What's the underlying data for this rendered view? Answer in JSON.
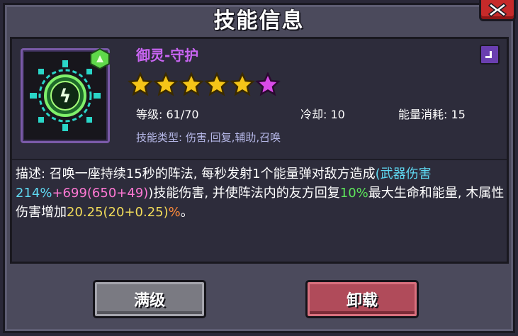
{
  "dialog": {
    "title": "技能信息",
    "close_icon": "close-icon"
  },
  "skill": {
    "name": "御灵-守护",
    "icon": "summon-array-icon",
    "element_badge": "wood-element-icon",
    "corner_badge": "purple-rarity-icon",
    "stars": {
      "total": 6,
      "gold": 5,
      "purple": 1
    },
    "level_label": "等级:",
    "level_value": "61/70",
    "cooldown_label": "冷却:",
    "cooldown_value": "10",
    "energy_label": "能量消耗:",
    "energy_value": "15",
    "type_text": "技能类型: 伤害,回复,辅助,召唤"
  },
  "description": {
    "p1": "描述: 召唤一座持续15秒的阵法, 每秒发射1个能量弹对敌方造成",
    "p2": "(武器伤害214%",
    "p3": "+699(650+49)",
    "p4": ")技能伤害, 并使阵法内的友方回复",
    "p5": "10%",
    "p6": "最大生命和能量, 木属性伤害增加",
    "p7": "20.25(20+0.25)",
    "p8": "%",
    "p9": "。"
  },
  "buttons": {
    "max_label": "满级",
    "unload_label": "卸载"
  },
  "colors": {
    "skill_name": "#c965f2",
    "weapon_damage": "#5fd9f2",
    "flat_damage": "#ff78d4",
    "heal_percent": "#5ee65c",
    "bonus_value": "#f2dc5a",
    "percent_sign": "#ff8a3a",
    "max_button": "#7a7a82",
    "unload_button": "#b04b5a",
    "close_button": "#c62a2a"
  }
}
